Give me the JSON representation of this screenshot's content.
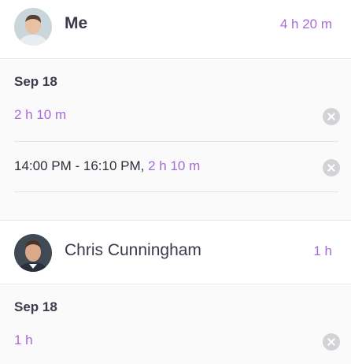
{
  "users": [
    {
      "name": "Me",
      "total": "4 h 20 m",
      "date": "Sep 18",
      "day_total": "2 h 10 m",
      "entries": [
        {
          "range": "14:00 PM - 16:10 PM,",
          "duration": "2 h 10 m"
        }
      ]
    },
    {
      "name": "Chris Cunningham",
      "total": "1 h",
      "date": "Sep 18",
      "day_total": "1 h"
    }
  ],
  "colors": {
    "accent": "#a56bd8",
    "remove": "#d3d3d7"
  },
  "icons": {
    "remove": "close-circle-icon"
  }
}
